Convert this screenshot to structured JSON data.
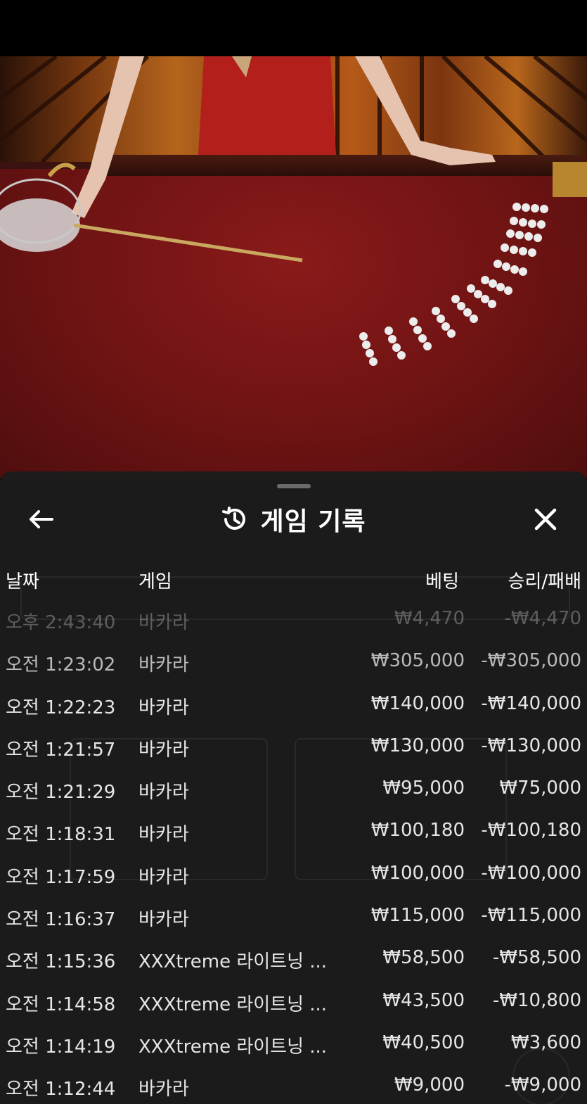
{
  "sheet": {
    "title": "게임 기록",
    "icons": {
      "back": "arrow-left-icon",
      "history": "history-clock-icon",
      "close": "close-x-icon"
    },
    "columns": {
      "date": "날짜",
      "game": "게임",
      "bet": "베팅",
      "win_loss": "승리/패배"
    },
    "rows": [
      {
        "date": "오후 2:43:40",
        "game": "바카라",
        "bet": "₩4,470",
        "win_loss": "-₩4,470"
      },
      {
        "date": "오전 1:23:02",
        "game": "바카라",
        "bet": "₩305,000",
        "win_loss": "-₩305,000"
      },
      {
        "date": "오전 1:22:23",
        "game": "바카라",
        "bet": "₩140,000",
        "win_loss": "-₩140,000"
      },
      {
        "date": "오전 1:21:57",
        "game": "바카라",
        "bet": "₩130,000",
        "win_loss": "-₩130,000"
      },
      {
        "date": "오전 1:21:29",
        "game": "바카라",
        "bet": "₩95,000",
        "win_loss": "₩75,000"
      },
      {
        "date": "오전 1:18:31",
        "game": "바카라",
        "bet": "₩100,180",
        "win_loss": "-₩100,180"
      },
      {
        "date": "오전 1:17:59",
        "game": "바카라",
        "bet": "₩100,000",
        "win_loss": "-₩100,000"
      },
      {
        "date": "오전 1:16:37",
        "game": "바카라",
        "bet": "₩115,000",
        "win_loss": "-₩115,000"
      },
      {
        "date": "오전 1:15:36",
        "game": "XXXtreme 라이트닝 ...",
        "bet": "₩58,500",
        "win_loss": "-₩58,500"
      },
      {
        "date": "오전 1:14:58",
        "game": "XXXtreme 라이트닝 ...",
        "bet": "₩43,500",
        "win_loss": "-₩10,800"
      },
      {
        "date": "오전 1:14:19",
        "game": "XXXtreme 라이트닝 ...",
        "bet": "₩40,500",
        "win_loss": "₩3,600"
      },
      {
        "date": "오전 1:12:44",
        "game": "바카라",
        "bet": "₩9,000",
        "win_loss": "-₩9,000"
      }
    ]
  },
  "colors": {
    "sheet_bg": "#1c1c1c",
    "text": "#e6e6e6",
    "felt": "#7a1616"
  }
}
